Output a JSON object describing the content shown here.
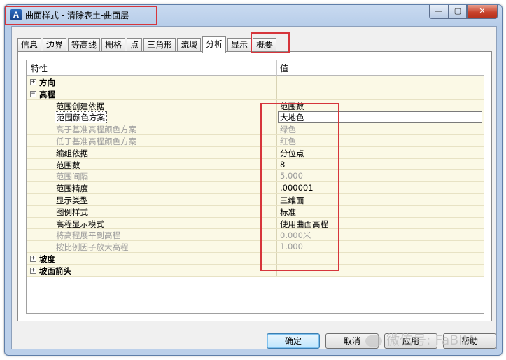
{
  "window": {
    "title": "曲面样式 - 清除表土-曲面层",
    "icon": "autocad-civil3d-icon",
    "controls": {
      "minimize": "—",
      "maximize": "▢",
      "close": "✕"
    }
  },
  "tabs": [
    {
      "label": "信息",
      "active": false
    },
    {
      "label": "边界",
      "active": false
    },
    {
      "label": "等高线",
      "active": false
    },
    {
      "label": "栅格",
      "active": false
    },
    {
      "label": "点",
      "active": false
    },
    {
      "label": "三角形",
      "active": false
    },
    {
      "label": "流域",
      "active": false
    },
    {
      "label": "分析",
      "active": true
    },
    {
      "label": "显示",
      "active": false
    },
    {
      "label": "概要",
      "active": false
    }
  ],
  "grid": {
    "columns": [
      "特性",
      "值"
    ],
    "rows": [
      {
        "type": "category",
        "expanded": false,
        "toggle": "⊞",
        "label": "方向",
        "value": ""
      },
      {
        "type": "category",
        "expanded": true,
        "toggle": "⊟",
        "label": "高程",
        "value": ""
      },
      {
        "type": "property",
        "label": "范围创建依据",
        "value": "范围数",
        "disabled": false,
        "selected": false
      },
      {
        "type": "property",
        "label": "范围颜色方案",
        "value": "大地色",
        "disabled": false,
        "selected": true
      },
      {
        "type": "property",
        "label": "高于基准高程颜色方案",
        "value": "绿色",
        "disabled": true,
        "selected": false
      },
      {
        "type": "property",
        "label": "低于基准高程颜色方案",
        "value": "红色",
        "disabled": true,
        "selected": false
      },
      {
        "type": "property",
        "label": "编组依据",
        "value": "分位点",
        "disabled": false,
        "selected": false
      },
      {
        "type": "property",
        "label": "范围数",
        "value": "8",
        "disabled": false,
        "selected": false
      },
      {
        "type": "property",
        "label": "范围间隔",
        "value": "5.000",
        "disabled": true,
        "selected": false
      },
      {
        "type": "property",
        "label": "范围精度",
        "value": ".000001",
        "disabled": false,
        "selected": false
      },
      {
        "type": "property",
        "label": "显示类型",
        "value": "三维面",
        "disabled": false,
        "selected": false
      },
      {
        "type": "property",
        "label": "图例样式",
        "value": "标准",
        "disabled": false,
        "selected": false
      },
      {
        "type": "property",
        "label": "高程显示模式",
        "value": "使用曲面高程",
        "disabled": false,
        "selected": false
      },
      {
        "type": "property",
        "label": "将高程展平到高程",
        "value": "0.000米",
        "disabled": true,
        "selected": false
      },
      {
        "type": "property",
        "label": "按比例因子放大高程",
        "value": "1.000",
        "disabled": true,
        "selected": false
      },
      {
        "type": "category",
        "expanded": false,
        "toggle": "⊞",
        "label": "坡度",
        "value": ""
      },
      {
        "type": "category",
        "expanded": false,
        "toggle": "⊞",
        "label": "坡面箭头",
        "value": ""
      }
    ]
  },
  "buttons": {
    "ok": "确定",
    "cancel": "取消",
    "apply": "应用",
    "help": "帮助"
  },
  "watermark": "微信号: FaBIM",
  "colors": {
    "highlight": "#d6353b",
    "row_bg": "#fbf9e6",
    "title_gradient": "#c9daf0"
  }
}
